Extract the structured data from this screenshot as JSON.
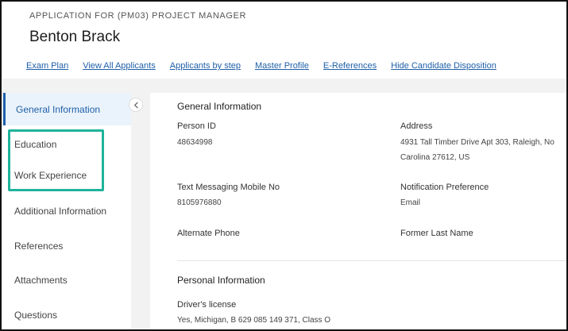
{
  "header": {
    "subtitle": "APPLICATION FOR (PM03) PROJECT MANAGER",
    "title": "Benton Brack"
  },
  "links": [
    "Exam Plan",
    "View All Applicants",
    "Applicants by step",
    "Master Profile",
    "E-References",
    "Hide Candidate Disposition"
  ],
  "sidebar": {
    "items": [
      {
        "label": "General Information",
        "active": true
      },
      {
        "label": "Education"
      },
      {
        "label": "Work Experience"
      },
      {
        "label": "Additional Information"
      },
      {
        "label": "References"
      },
      {
        "label": "Attachments"
      },
      {
        "label": "Questions"
      }
    ]
  },
  "general": {
    "title": "General Information",
    "person_id_label": "Person ID",
    "person_id": "48634998",
    "address_label": "Address",
    "address_line1": "4931 Tall Timber Drive Apt 303, Raleigh, No",
    "address_line2": "Carolina 27612, US",
    "mobile_label": "Text Messaging Mobile No",
    "mobile": "8105976880",
    "notification_label": "Notification Preference",
    "notification": "Email",
    "alt_phone_label": "Alternate Phone",
    "former_last_name_label": "Former Last Name"
  },
  "personal": {
    "title": "Personal Information",
    "license_label": "Driver's license",
    "license": "Yes, Michigan, B 629 085 149 371, Class O"
  },
  "colors": {
    "link": "#1f5fa8",
    "highlight": "#1fb39b",
    "active_bg": "#eaf3fb"
  }
}
